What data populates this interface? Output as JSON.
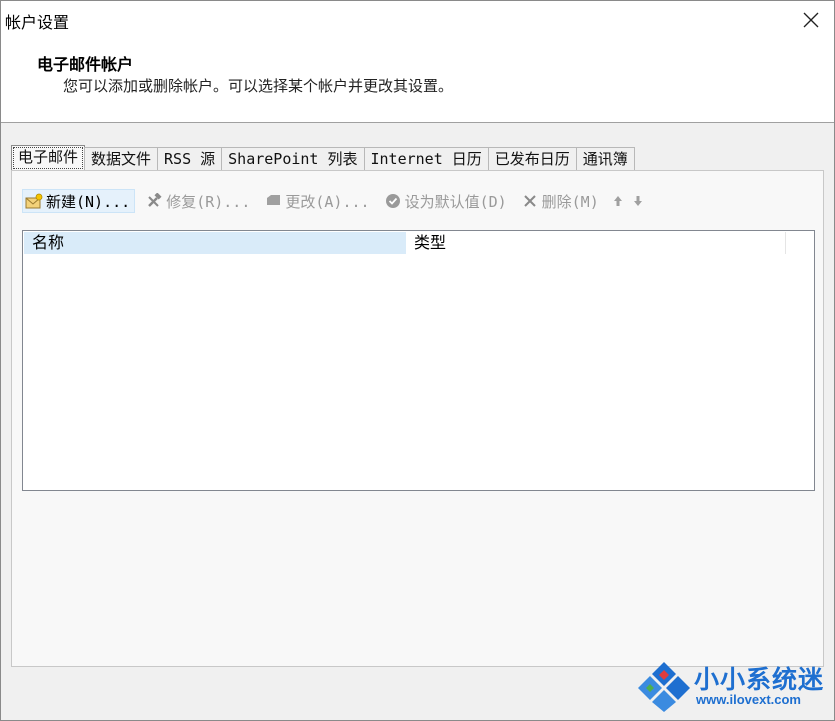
{
  "window": {
    "title": "帐户设置"
  },
  "header": {
    "title": "电子邮件帐户",
    "description": "您可以添加或删除帐户。可以选择某个帐户并更改其设置。"
  },
  "tabs": [
    {
      "label": "电子邮件"
    },
    {
      "label": "数据文件"
    },
    {
      "label": "RSS 源"
    },
    {
      "label": "SharePoint 列表"
    },
    {
      "label": "Internet 日历"
    },
    {
      "label": "已发布日历"
    },
    {
      "label": "通讯簿"
    }
  ],
  "toolbar": {
    "new_label": "新建(N)...",
    "repair_label": "修复(R)...",
    "change_label": "更改(A)...",
    "default_label": "设为默认值(D)",
    "delete_label": "删除(M)"
  },
  "list": {
    "columns": [
      {
        "label": "名称"
      },
      {
        "label": "类型"
      }
    ]
  },
  "watermark": {
    "text": "小小系统迷",
    "url": "www.ilovext.com"
  },
  "colors": {
    "accent": "#1e6fd0",
    "selected_header": "#d9ebf9"
  }
}
